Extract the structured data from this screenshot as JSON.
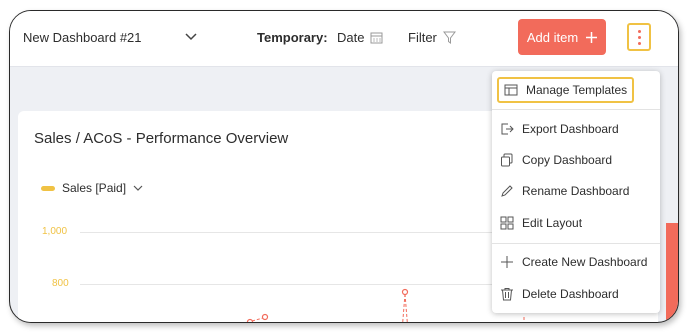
{
  "header": {
    "dashboard_name": "New Dashboard #21",
    "temporary_label": "Temporary:",
    "date_label": "Date",
    "filter_label": "Filter",
    "add_item_label": "Add item"
  },
  "menu": {
    "items": [
      {
        "label": "Manage Templates",
        "icon": "template-icon"
      },
      {
        "label": "Export Dashboard",
        "icon": "export-icon"
      },
      {
        "label": "Copy Dashboard",
        "icon": "copy-icon"
      },
      {
        "label": "Rename Dashboard",
        "icon": "pencil-icon"
      },
      {
        "label": "Edit Layout",
        "icon": "layout-grid-icon"
      },
      {
        "label": "Create New Dashboard",
        "icon": "plus-icon"
      },
      {
        "label": "Delete Dashboard",
        "icon": "trash-icon"
      }
    ]
  },
  "card": {
    "title": "Sales / ACoS - Performance Overview",
    "legend_label": "Sales [Paid]"
  },
  "chart_data": {
    "type": "line",
    "series": [
      {
        "name": "Sales [Paid]",
        "values": []
      }
    ],
    "yticks": [
      "1,000",
      "800"
    ]
  },
  "colors": {
    "accent": "#f26b5b",
    "highlight": "#f0c244"
  }
}
